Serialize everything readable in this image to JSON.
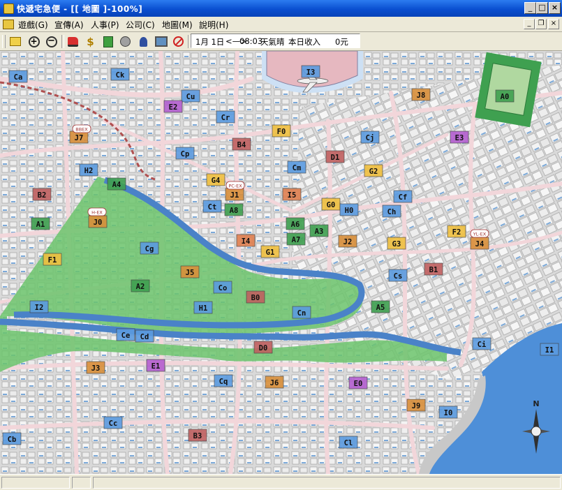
{
  "window": {
    "title": "快遞宅急便 - [[ 地圖 ]-100%]",
    "controls": {
      "minimize": "_",
      "maximize": "□",
      "close": "×"
    }
  },
  "menubar": {
    "items": [
      "遊戲(G)",
      "宣傳(A)",
      "人事(P)",
      "公司(C)",
      "地圖(M)",
      "說明(H)"
    ],
    "mdi_controls": {
      "minimize": "_",
      "restore": "❐",
      "close": "×"
    }
  },
  "toolbar": {
    "icons": [
      "folder-icon",
      "zoom-in-icon",
      "zoom-out-icon",
      "truck-icon",
      "money-icon",
      "ledger-icon",
      "phone-icon",
      "staff-icon",
      "computer-icon",
      "stop-icon"
    ],
    "status": {
      "date": "1月 1日",
      "arrow": "<—>",
      "time": "08:03",
      "weather": "天氣晴",
      "income_label": "本日收入",
      "income_value": "0元"
    }
  },
  "map": {
    "compass": "N",
    "districts": [
      {
        "id": "Ca",
        "color": "#5b9be0"
      },
      {
        "id": "Ck",
        "color": "#5b9be0"
      },
      {
        "id": "Cu",
        "color": "#5b9be0"
      },
      {
        "id": "E2",
        "color": "#b45fd0"
      },
      {
        "id": "Cr",
        "color": "#5b9be0"
      },
      {
        "id": "J7",
        "color": "#d98f3a"
      },
      {
        "id": "F0",
        "color": "#f0c040"
      },
      {
        "id": "B4",
        "color": "#c06060"
      },
      {
        "id": "Cp",
        "color": "#5b9be0"
      },
      {
        "id": "H2",
        "color": "#5b9be0"
      },
      {
        "id": "G4",
        "color": "#f0c040"
      },
      {
        "id": "Cm",
        "color": "#5b9be0"
      },
      {
        "id": "D1",
        "color": "#c06060"
      },
      {
        "id": "Cj",
        "color": "#5b9be0"
      },
      {
        "id": "G2",
        "color": "#f0c040"
      },
      {
        "id": "A4",
        "color": "#3fa050"
      },
      {
        "id": "B2",
        "color": "#c06060"
      },
      {
        "id": "J1",
        "color": "#d98f3a"
      },
      {
        "id": "I5",
        "color": "#e08050"
      },
      {
        "id": "Ct",
        "color": "#5b9be0"
      },
      {
        "id": "A8",
        "color": "#3fa050"
      },
      {
        "id": "G0",
        "color": "#f0c040"
      },
      {
        "id": "H0",
        "color": "#5b9be0"
      },
      {
        "id": "Ch",
        "color": "#5b9be0"
      },
      {
        "id": "Cf",
        "color": "#5b9be0"
      },
      {
        "id": "A1",
        "color": "#3fa050"
      },
      {
        "id": "J0",
        "color": "#d98f3a"
      },
      {
        "id": "A6",
        "color": "#3fa050"
      },
      {
        "id": "A3",
        "color": "#3fa050"
      },
      {
        "id": "F2",
        "color": "#f0c040"
      },
      {
        "id": "J4",
        "color": "#d98f3a"
      },
      {
        "id": "I4",
        "color": "#e08050"
      },
      {
        "id": "A7",
        "color": "#3fa050"
      },
      {
        "id": "J2",
        "color": "#d98f3a"
      },
      {
        "id": "G3",
        "color": "#f0c040"
      },
      {
        "id": "Cg",
        "color": "#5b9be0"
      },
      {
        "id": "G1",
        "color": "#f0c040"
      },
      {
        "id": "F1",
        "color": "#f0c040"
      },
      {
        "id": "J5",
        "color": "#d98f3a"
      },
      {
        "id": "B1",
        "color": "#c06060"
      },
      {
        "id": "A2",
        "color": "#3fa050"
      },
      {
        "id": "Co",
        "color": "#5b9be0"
      },
      {
        "id": "B0",
        "color": "#c06060"
      },
      {
        "id": "Cs",
        "color": "#5b9be0"
      },
      {
        "id": "I2",
        "color": "#5b9be0"
      },
      {
        "id": "H1",
        "color": "#5b9be0"
      },
      {
        "id": "Cn",
        "color": "#5b9be0"
      },
      {
        "id": "A5",
        "color": "#3fa050"
      },
      {
        "id": "Ce",
        "color": "#5b9be0"
      },
      {
        "id": "Cd",
        "color": "#5b9be0"
      },
      {
        "id": "D0",
        "color": "#c06060"
      },
      {
        "id": "Ci",
        "color": "#5b9be0"
      },
      {
        "id": "I1",
        "color": "#5b9be0"
      },
      {
        "id": "E1",
        "color": "#b45fd0"
      },
      {
        "id": "J3",
        "color": "#d98f3a"
      },
      {
        "id": "Cq",
        "color": "#5b9be0"
      },
      {
        "id": "J6",
        "color": "#d98f3a"
      },
      {
        "id": "E0",
        "color": "#b45fd0"
      },
      {
        "id": "J9",
        "color": "#d98f3a"
      },
      {
        "id": "I0",
        "color": "#5b9be0"
      },
      {
        "id": "Cc",
        "color": "#5b9be0"
      },
      {
        "id": "Cb",
        "color": "#5b9be0"
      },
      {
        "id": "B3",
        "color": "#c06060"
      },
      {
        "id": "Cl",
        "color": "#5b9be0"
      },
      {
        "id": "I3",
        "color": "#5b9be0"
      },
      {
        "id": "J8",
        "color": "#d98f3a"
      },
      {
        "id": "A0",
        "color": "#3fa050"
      },
      {
        "id": "E3",
        "color": "#b45fd0"
      }
    ],
    "signs": [
      "BBEX",
      "PC-EX",
      "H-EX",
      "YL-EX"
    ]
  }
}
